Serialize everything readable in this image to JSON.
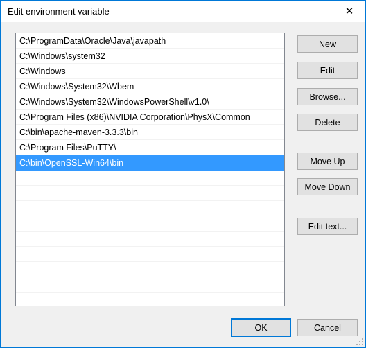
{
  "window": {
    "title": "Edit environment variable",
    "close_icon": "close-icon",
    "accent_color": "#0078d7",
    "selection_color": "#3399ff",
    "background_color": "#f0f0f0"
  },
  "path_list": {
    "selected_index": 8,
    "visible_empty_rows": 8,
    "entries": [
      "C:\\ProgramData\\Oracle\\Java\\javapath",
      "C:\\Windows\\system32",
      "C:\\Windows",
      "C:\\Windows\\System32\\Wbem",
      "C:\\Windows\\System32\\WindowsPowerShell\\v1.0\\",
      "C:\\Program Files (x86)\\NVIDIA Corporation\\PhysX\\Common",
      "C:\\bin\\apache-maven-3.3.3\\bin",
      "C:\\Program Files\\PuTTY\\",
      "C:\\bin\\OpenSSL-Win64\\bin"
    ]
  },
  "side_buttons": {
    "new": "New",
    "edit": "Edit",
    "browse": "Browse...",
    "delete": "Delete",
    "move_up": "Move Up",
    "move_down": "Move Down",
    "edit_text": "Edit text..."
  },
  "footer": {
    "ok": "OK",
    "cancel": "Cancel"
  }
}
